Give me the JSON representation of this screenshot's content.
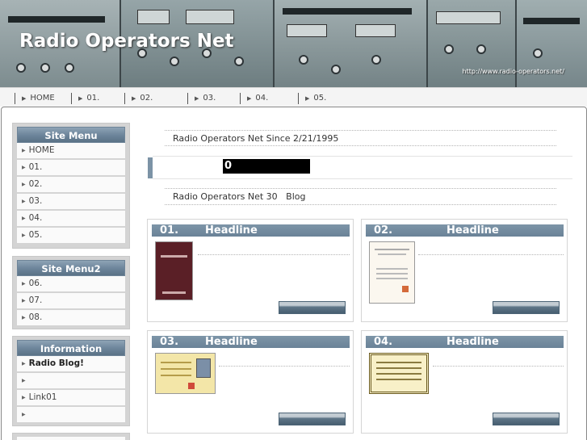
{
  "header": {
    "title": "Radio Operators Net",
    "url": "http://www.radio-operators.net/"
  },
  "nav": {
    "items": [
      {
        "label": "HOME"
      },
      {
        "label": "01."
      },
      {
        "label": "02."
      },
      {
        "label": "03."
      },
      {
        "label": "04."
      },
      {
        "label": "05."
      }
    ]
  },
  "sidebar": {
    "menu1": {
      "title": "Site Menu",
      "items": [
        "HOME",
        "01.",
        "02.",
        "03.",
        "04.",
        "05."
      ]
    },
    "menu2": {
      "title": "Site Menu2",
      "items": [
        "06.",
        "07.",
        "08."
      ]
    },
    "info": {
      "title": "Information",
      "items": [
        "Radio Blog!",
        "",
        "Link01",
        ""
      ]
    }
  },
  "main": {
    "since_text": "Radio Operators Net Since 2/21/1995",
    "counter_value": "0",
    "blog_text": "Radio Operators Net 30   Blog",
    "cards": [
      {
        "number": "01.",
        "title": "Headline",
        "image": "book-cover-image"
      },
      {
        "number": "02.",
        "title": "Headline",
        "image": "certificate-document-image"
      },
      {
        "number": "03.",
        "title": "Headline",
        "image": "id-license-card-image"
      },
      {
        "number": "04.",
        "title": "Headline",
        "image": "framed-certificate-image"
      }
    ]
  },
  "colors": {
    "accent": "#6a8297",
    "sidebar_bg": "#d4d4d4",
    "counter_bg": "#000000"
  }
}
